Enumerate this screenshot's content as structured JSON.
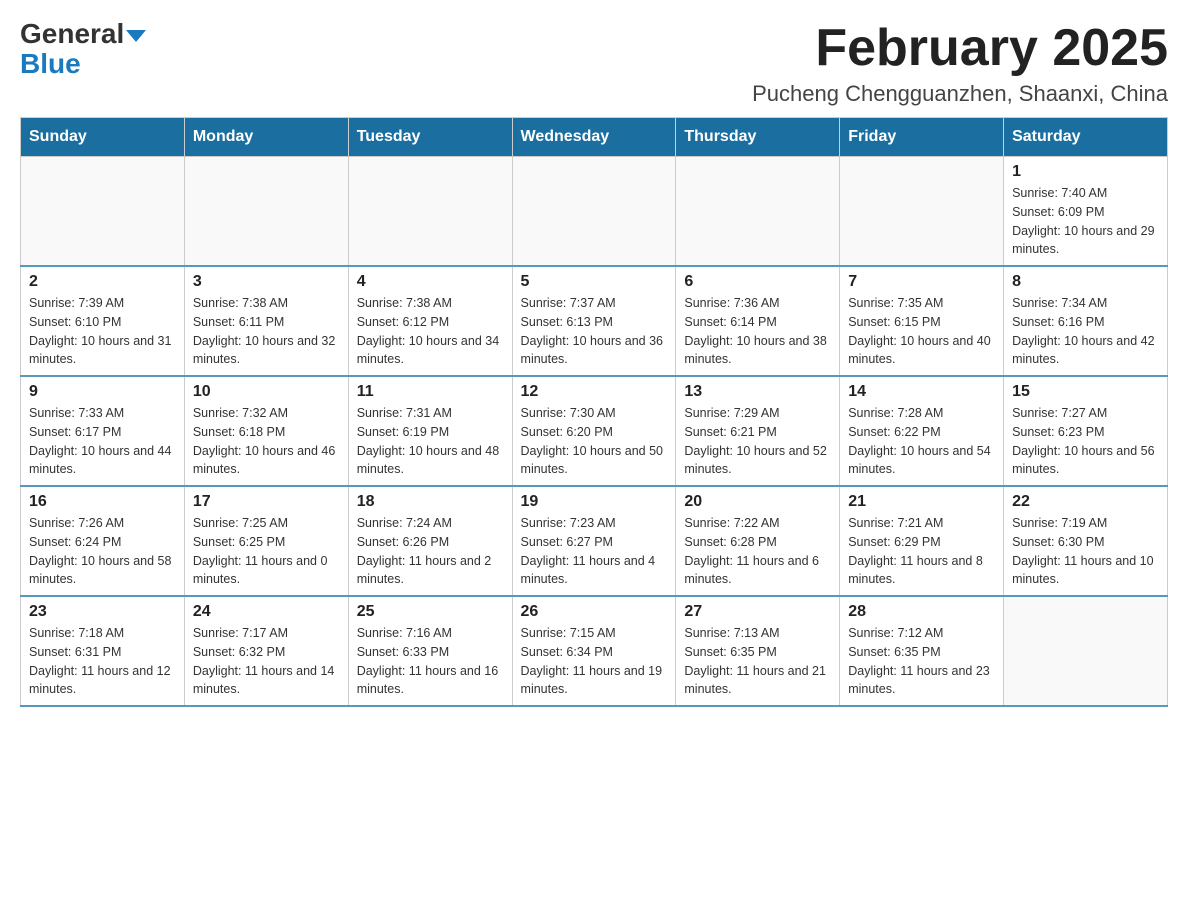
{
  "header": {
    "logo_part1": "General",
    "logo_part2": "Blue",
    "title": "February 2025",
    "subtitle": "Pucheng Chengguanzhen, Shaanxi, China"
  },
  "calendar": {
    "weekdays": [
      "Sunday",
      "Monday",
      "Tuesday",
      "Wednesday",
      "Thursday",
      "Friday",
      "Saturday"
    ],
    "weeks": [
      [
        {
          "day": "",
          "info": ""
        },
        {
          "day": "",
          "info": ""
        },
        {
          "day": "",
          "info": ""
        },
        {
          "day": "",
          "info": ""
        },
        {
          "day": "",
          "info": ""
        },
        {
          "day": "",
          "info": ""
        },
        {
          "day": "1",
          "info": "Sunrise: 7:40 AM\nSunset: 6:09 PM\nDaylight: 10 hours and 29 minutes."
        }
      ],
      [
        {
          "day": "2",
          "info": "Sunrise: 7:39 AM\nSunset: 6:10 PM\nDaylight: 10 hours and 31 minutes."
        },
        {
          "day": "3",
          "info": "Sunrise: 7:38 AM\nSunset: 6:11 PM\nDaylight: 10 hours and 32 minutes."
        },
        {
          "day": "4",
          "info": "Sunrise: 7:38 AM\nSunset: 6:12 PM\nDaylight: 10 hours and 34 minutes."
        },
        {
          "day": "5",
          "info": "Sunrise: 7:37 AM\nSunset: 6:13 PM\nDaylight: 10 hours and 36 minutes."
        },
        {
          "day": "6",
          "info": "Sunrise: 7:36 AM\nSunset: 6:14 PM\nDaylight: 10 hours and 38 minutes."
        },
        {
          "day": "7",
          "info": "Sunrise: 7:35 AM\nSunset: 6:15 PM\nDaylight: 10 hours and 40 minutes."
        },
        {
          "day": "8",
          "info": "Sunrise: 7:34 AM\nSunset: 6:16 PM\nDaylight: 10 hours and 42 minutes."
        }
      ],
      [
        {
          "day": "9",
          "info": "Sunrise: 7:33 AM\nSunset: 6:17 PM\nDaylight: 10 hours and 44 minutes."
        },
        {
          "day": "10",
          "info": "Sunrise: 7:32 AM\nSunset: 6:18 PM\nDaylight: 10 hours and 46 minutes."
        },
        {
          "day": "11",
          "info": "Sunrise: 7:31 AM\nSunset: 6:19 PM\nDaylight: 10 hours and 48 minutes."
        },
        {
          "day": "12",
          "info": "Sunrise: 7:30 AM\nSunset: 6:20 PM\nDaylight: 10 hours and 50 minutes."
        },
        {
          "day": "13",
          "info": "Sunrise: 7:29 AM\nSunset: 6:21 PM\nDaylight: 10 hours and 52 minutes."
        },
        {
          "day": "14",
          "info": "Sunrise: 7:28 AM\nSunset: 6:22 PM\nDaylight: 10 hours and 54 minutes."
        },
        {
          "day": "15",
          "info": "Sunrise: 7:27 AM\nSunset: 6:23 PM\nDaylight: 10 hours and 56 minutes."
        }
      ],
      [
        {
          "day": "16",
          "info": "Sunrise: 7:26 AM\nSunset: 6:24 PM\nDaylight: 10 hours and 58 minutes."
        },
        {
          "day": "17",
          "info": "Sunrise: 7:25 AM\nSunset: 6:25 PM\nDaylight: 11 hours and 0 minutes."
        },
        {
          "day": "18",
          "info": "Sunrise: 7:24 AM\nSunset: 6:26 PM\nDaylight: 11 hours and 2 minutes."
        },
        {
          "day": "19",
          "info": "Sunrise: 7:23 AM\nSunset: 6:27 PM\nDaylight: 11 hours and 4 minutes."
        },
        {
          "day": "20",
          "info": "Sunrise: 7:22 AM\nSunset: 6:28 PM\nDaylight: 11 hours and 6 minutes."
        },
        {
          "day": "21",
          "info": "Sunrise: 7:21 AM\nSunset: 6:29 PM\nDaylight: 11 hours and 8 minutes."
        },
        {
          "day": "22",
          "info": "Sunrise: 7:19 AM\nSunset: 6:30 PM\nDaylight: 11 hours and 10 minutes."
        }
      ],
      [
        {
          "day": "23",
          "info": "Sunrise: 7:18 AM\nSunset: 6:31 PM\nDaylight: 11 hours and 12 minutes."
        },
        {
          "day": "24",
          "info": "Sunrise: 7:17 AM\nSunset: 6:32 PM\nDaylight: 11 hours and 14 minutes."
        },
        {
          "day": "25",
          "info": "Sunrise: 7:16 AM\nSunset: 6:33 PM\nDaylight: 11 hours and 16 minutes."
        },
        {
          "day": "26",
          "info": "Sunrise: 7:15 AM\nSunset: 6:34 PM\nDaylight: 11 hours and 19 minutes."
        },
        {
          "day": "27",
          "info": "Sunrise: 7:13 AM\nSunset: 6:35 PM\nDaylight: 11 hours and 21 minutes."
        },
        {
          "day": "28",
          "info": "Sunrise: 7:12 AM\nSunset: 6:35 PM\nDaylight: 11 hours and 23 minutes."
        },
        {
          "day": "",
          "info": ""
        }
      ]
    ]
  }
}
